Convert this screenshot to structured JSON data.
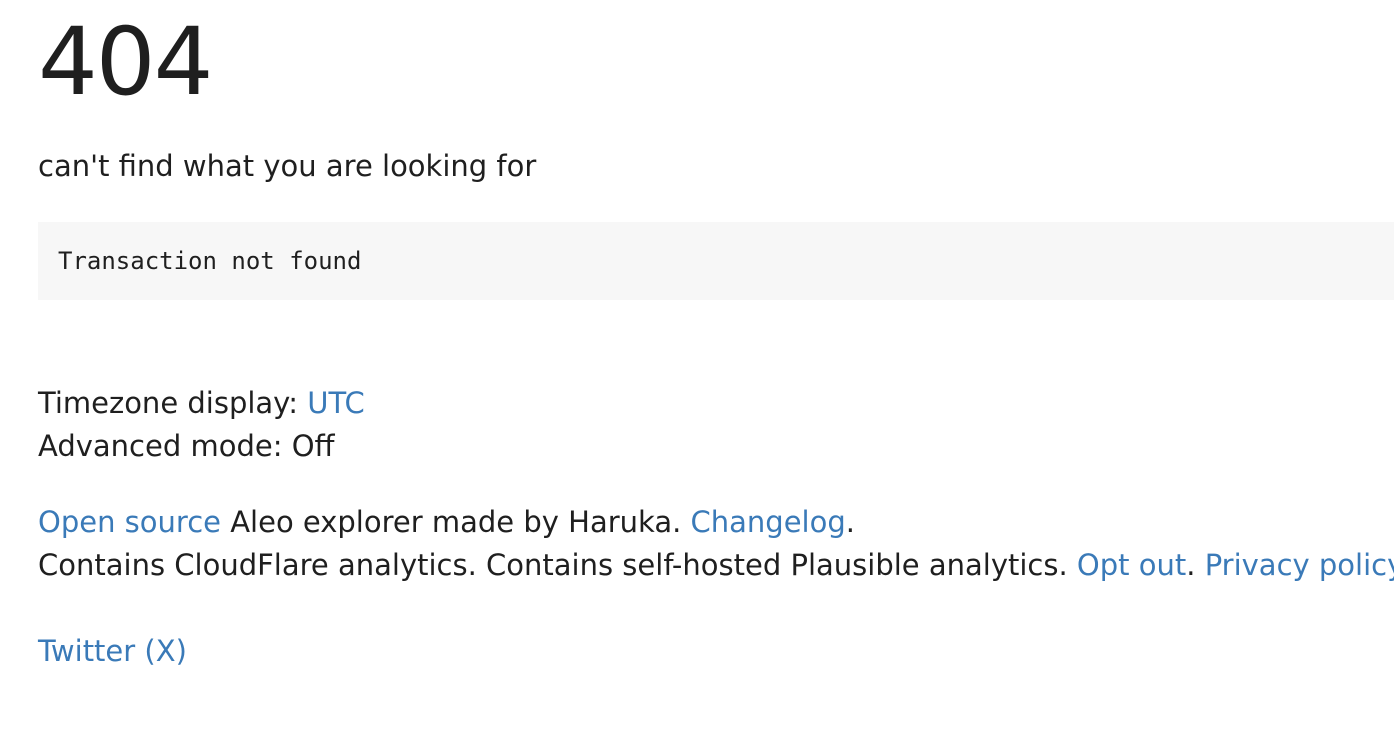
{
  "error": {
    "code": "404",
    "message": "can't find what you are looking for",
    "detail": "Transaction not found"
  },
  "settings": {
    "timezone_label": "Timezone display: ",
    "timezone_value": "UTC",
    "advanced_label": "Advanced mode: ",
    "advanced_value": "Off"
  },
  "footer": {
    "open_source_link": "Open source",
    "made_by_text": " Aleo explorer made by Haruka. ",
    "changelog_link": "Changelog",
    "period": ".",
    "analytics_text": "Contains CloudFlare analytics. Contains self-hosted Plausible analytics. ",
    "opt_out_link": "Opt out",
    "separator": ". ",
    "privacy_link": "Privacy policy",
    "end_period": ".",
    "twitter_link": "Twitter (X)"
  },
  "colors": {
    "link": "#3a7ab8",
    "text": "#1f1f1f",
    "code_background": "#f7f7f7"
  }
}
